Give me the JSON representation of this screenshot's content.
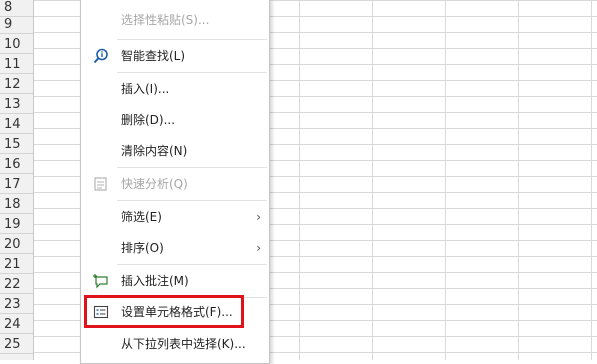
{
  "rows": [
    "8",
    "9",
    "10",
    "11",
    "12",
    "13",
    "14",
    "15",
    "16",
    "17",
    "18",
    "19",
    "20",
    "21",
    "22",
    "23",
    "24",
    "25"
  ],
  "menu": {
    "items": [
      {
        "id": "paste-special",
        "label": "选择性粘贴(S)...",
        "disabled": true,
        "icon": ""
      },
      {
        "id": "smart-lookup",
        "label": "智能查找(L)",
        "disabled": false,
        "icon": "smart-lookup-icon"
      },
      {
        "id": "insert",
        "label": "插入(I)...",
        "disabled": false,
        "icon": ""
      },
      {
        "id": "delete",
        "label": "删除(D)...",
        "disabled": false,
        "icon": ""
      },
      {
        "id": "clear-contents",
        "label": "清除内容(N)",
        "disabled": false,
        "icon": ""
      },
      {
        "id": "quick-analysis",
        "label": "快速分析(Q)",
        "disabled": true,
        "icon": "quick-analysis-icon"
      },
      {
        "id": "filter",
        "label": "筛选(E)",
        "disabled": false,
        "icon": "",
        "submenu": true
      },
      {
        "id": "sort",
        "label": "排序(O)",
        "disabled": false,
        "icon": "",
        "submenu": true
      },
      {
        "id": "insert-comment",
        "label": "插入批注(M)",
        "disabled": false,
        "icon": "comment-icon"
      },
      {
        "id": "format-cells",
        "label": "设置单元格格式(F)...",
        "disabled": false,
        "icon": "format-cells-icon",
        "highlighted": true
      },
      {
        "id": "pick-from-list",
        "label": "从下拉列表中选择(K)...",
        "disabled": false,
        "icon": ""
      }
    ],
    "submenu_arrow": "›",
    "highlight_color": "#e0121b"
  }
}
